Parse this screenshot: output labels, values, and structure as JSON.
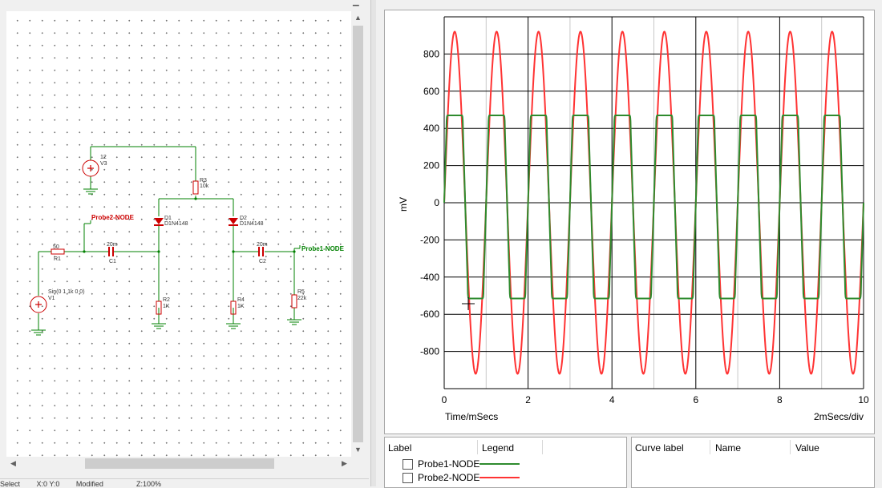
{
  "schematic": {
    "components": {
      "v3": {
        "value": "12",
        "ref": "V3"
      },
      "r3": {
        "ref": "R3",
        "value": "10k"
      },
      "d1": {
        "ref": "D1",
        "model": "D1N4148"
      },
      "d2": {
        "ref": "D2",
        "model": "D1N4148"
      },
      "r1": {
        "value": "50",
        "ref": "R1"
      },
      "c1": {
        "value": "20m",
        "ref": "C1"
      },
      "c2": {
        "value": "20m",
        "ref": "C2"
      },
      "v1": {
        "value": "Sin(0 1 1k 0 0)",
        "ref": "V1"
      },
      "r2": {
        "ref": "R2",
        "value": "1K"
      },
      "r4": {
        "ref": "R4",
        "value": "1K"
      },
      "r5": {
        "ref": "R5",
        "value": "22k"
      }
    },
    "probes": {
      "probe1": "Probe1-NODE",
      "probe2": "Probe2-NODE"
    },
    "colors": {
      "wire": "#008000",
      "component": "#cc0000",
      "probe1_label": "#008000",
      "probe2_label": "#cc0000",
      "ground": "#008000"
    }
  },
  "status_bar": [
    "Select",
    "X:0  Y:0",
    "Modified",
    "",
    "Z:100%"
  ],
  "graph": {
    "x_label": "Time/mSecs",
    "x_div_label": "2mSecs/div",
    "y_label": "mV",
    "grid": true
  },
  "chart_data": {
    "type": "line",
    "xlabel": "Time/mSecs",
    "ylabel": "mV",
    "xlim": [
      0,
      10
    ],
    "ylim": [
      -1000,
      1000
    ],
    "x_ticks": [
      "0",
      "2",
      "4",
      "6",
      "8",
      "10"
    ],
    "y_ticks": [
      "800",
      "600",
      "400",
      "200",
      "0",
      "-200",
      "-400",
      "-600",
      "-800"
    ],
    "series": [
      {
        "name": "Probe2-NODE",
        "color": "#ff3333",
        "amplitude_mv": 920,
        "frequency_khz": 1,
        "phase_deg": 0
      },
      {
        "name": "Probe1-NODE",
        "color": "#2e8b2e",
        "clip_high_mv": 470,
        "clip_low_mv": -515,
        "frequency_khz": 1,
        "phase_deg": 0
      }
    ]
  },
  "legend_panel": {
    "headers": [
      "Label",
      "Legend"
    ],
    "rows": [
      {
        "label": "Probe1-NODE",
        "color": "#2e8b2e",
        "checked": false
      },
      {
        "label": "Probe2-NODE",
        "color": "#ff3333",
        "checked": false
      }
    ]
  },
  "curve_panel": {
    "headers": [
      "Curve label",
      "Name",
      "Value"
    ]
  },
  "icons": {
    "vscroll_up": "chevron-up-icon",
    "vscroll_down": "chevron-down-icon",
    "hscroll_left": "chevron-left-icon",
    "hscroll_right": "chevron-right-icon",
    "cursor": "crosshair-cursor-icon"
  }
}
